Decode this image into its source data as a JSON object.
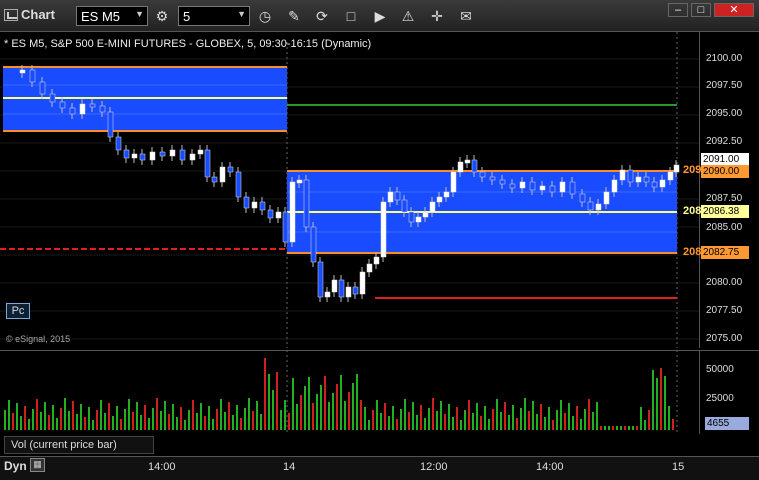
{
  "toolbar": {
    "title": "Chart",
    "symbol": "ES M5",
    "interval": "5",
    "window_buttons": [
      "–",
      "□",
      "✕"
    ]
  },
  "chart": {
    "header": "* ES M5, S&P 500 E-MINI FUTURES - GLOBEX, 5, 09:30-16:15 (Dynamic)",
    "credit": "© eSignal, 2015",
    "pc_label": "Pc",
    "price_ticks": [
      "2100.00",
      "2097.50",
      "2095.00",
      "2092.50",
      "2090.00",
      "2087.50",
      "2085.00",
      "2082.50",
      "2080.00",
      "2077.50",
      "2075.00"
    ],
    "price_tags": [
      {
        "label": "2091.00",
        "bg": "#ffffff",
        "fg": "#000000"
      },
      {
        "label": "2090.00",
        "bg": "#ff9933",
        "fg": "#000000"
      },
      {
        "label": "2086.38",
        "bg": "#ffff99",
        "fg": "#000000"
      },
      {
        "label": "2082.75",
        "bg": "#ff9933",
        "fg": "#000000"
      }
    ],
    "cut_labels": [
      "209",
      "208",
      "208"
    ],
    "colors": {
      "zone": "#1a4cff",
      "orange": "#ff8c28",
      "yellow": "#ffff80",
      "green": "#2a9a2a",
      "red": "#e02020",
      "magenta": "#ff2bd6",
      "dkgreen": "#2bb82b"
    }
  },
  "volume": {
    "label": "Vol (current price bar)",
    "ticks": [
      "50000",
      "25000"
    ],
    "current": "4655"
  },
  "time_axis": {
    "dyn": "Dyn",
    "labels": [
      "14:00",
      "14",
      "12:00",
      "14:00",
      "15"
    ]
  }
}
